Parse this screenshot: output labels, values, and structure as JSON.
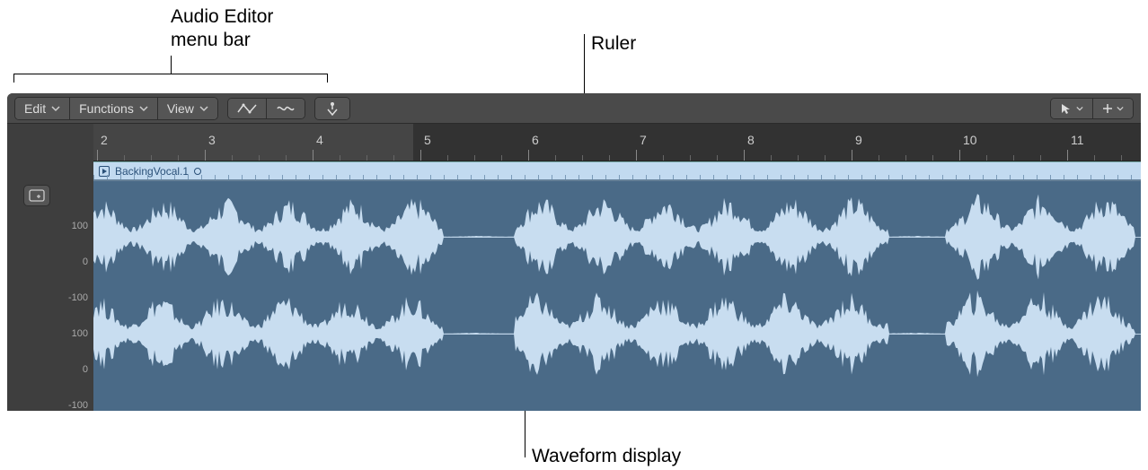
{
  "callouts": {
    "menubar": "Audio Editor\nmenu bar",
    "ruler": "Ruler",
    "waveform": "Waveform display"
  },
  "menubar": {
    "edit": "Edit",
    "functions": "Functions",
    "view": "View"
  },
  "tool_icons": {
    "automation": "automation-curve-icon",
    "flex": "flex-icon",
    "marquee": "catch-playhead-icon",
    "pointer": "pointer-tool-icon",
    "plus": "plus-tool-icon"
  },
  "ruler": {
    "bars": [
      2,
      3,
      4,
      5,
      6,
      7,
      8,
      9,
      10,
      11
    ]
  },
  "region": {
    "name": "BackingVocal.1"
  },
  "amplitude_scale": [
    "100",
    "0",
    "-100",
    "100",
    "0",
    "-100"
  ],
  "colors": {
    "waveform_fill": "#c8ddf0",
    "waveform_bg": "#4a6a87",
    "region_header": "#c2daf0"
  }
}
